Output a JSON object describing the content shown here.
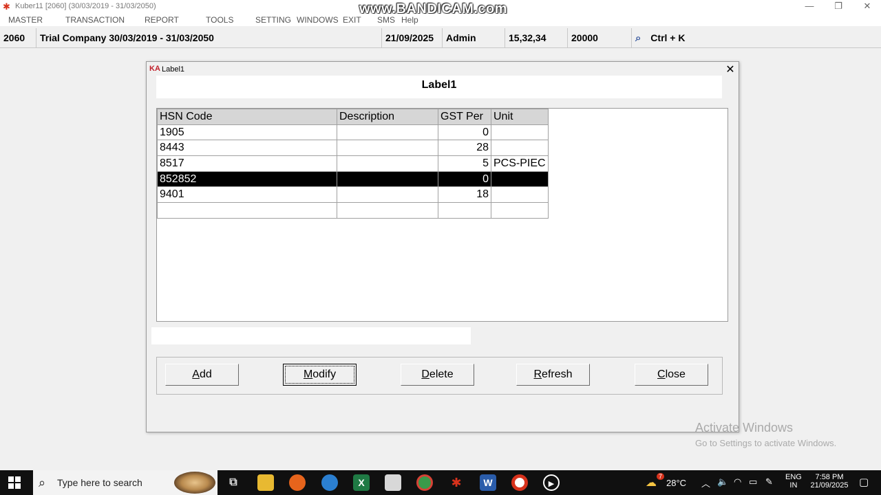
{
  "window": {
    "title": "Kuber11 [2060] (30/03/2019 - 31/03/2050)",
    "watermark": "www.BANDICAM.com"
  },
  "menu": [
    "MASTER",
    "TRANSACTION",
    "REPORT",
    "TOOLS",
    "SETTING",
    "WINDOWS",
    "EXIT",
    "SMS",
    "Help"
  ],
  "status": {
    "code": "2060",
    "company": "Trial Company  30/03/2019 - 31/03/2050",
    "date": "21/09/2025",
    "user": "Admin",
    "numbers": "15,32,34",
    "amount": "20000",
    "shortcut": "Ctrl + K"
  },
  "dialog": {
    "title": "Label1",
    "header": "Label1",
    "columns": [
      "HSN Code",
      "Description",
      "GST Per",
      "Unit"
    ],
    "rows": [
      {
        "hsn": "1905",
        "description": "",
        "gst": "0",
        "unit": ""
      },
      {
        "hsn": "8443",
        "description": "",
        "gst": "28",
        "unit": ""
      },
      {
        "hsn": "8517",
        "description": "",
        "gst": "5",
        "unit": "PCS-PIEC"
      },
      {
        "hsn": "852852",
        "description": "",
        "gst": "0",
        "unit": ""
      },
      {
        "hsn": "9401",
        "description": "",
        "gst": "18",
        "unit": ""
      },
      {
        "hsn": "",
        "description": "",
        "gst": "",
        "unit": ""
      }
    ],
    "selected_row": 3,
    "buttons": {
      "add": {
        "accel": "A",
        "rest": "dd"
      },
      "modify": {
        "accel": "M",
        "rest": "odify"
      },
      "delete": {
        "accel": "D",
        "rest": "elete"
      },
      "refresh": {
        "accel": "R",
        "rest": "efresh"
      },
      "close": {
        "accel": "C",
        "rest": "lose"
      }
    },
    "focused_button": "modify"
  },
  "activation": {
    "line1": "Activate Windows",
    "line2": "Go to Settings to activate Windows."
  },
  "taskbar": {
    "search_placeholder": "Type here to search",
    "weather": "28°C",
    "weather_badge": "7",
    "lang1": "ENG",
    "lang2": "IN",
    "time": "7:58 PM",
    "date": "21/09/2025"
  },
  "colors": {
    "selected_row_bg": "#000000",
    "grid_header_bg": "#d6d6d6",
    "app_icon": "#d8321c"
  }
}
